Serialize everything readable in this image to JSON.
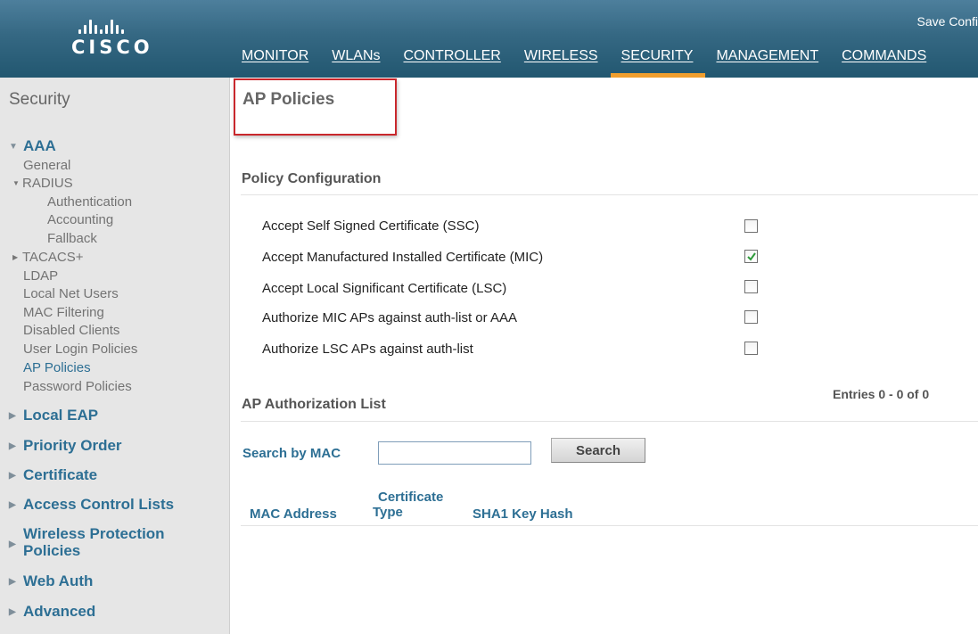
{
  "header": {
    "logo_text": "CISCO",
    "save_config": "Save Confi",
    "nav": [
      {
        "label": "MONITOR"
      },
      {
        "label": "WLANs"
      },
      {
        "label": "CONTROLLER"
      },
      {
        "label": "WIRELESS"
      },
      {
        "label": "SECURITY",
        "active": true
      },
      {
        "label": "MANAGEMENT"
      },
      {
        "label": "COMMANDS"
      }
    ]
  },
  "sidebar": {
    "title": "Security",
    "sections": {
      "aaa": "AAA",
      "local_eap": "Local EAP",
      "priority_order": "Priority Order",
      "certificate": "Certificate",
      "acl": "Access Control Lists",
      "wireless_protection_1": "Wireless Protection",
      "wireless_protection_2": "Policies",
      "web_auth": "Web Auth",
      "advanced": "Advanced"
    },
    "aaa_items": {
      "general": "General",
      "radius": "RADIUS",
      "authentication": "Authentication",
      "accounting": "Accounting",
      "fallback": "Fallback",
      "tacacs": "TACACS+",
      "ldap": "LDAP",
      "local_net_users": "Local Net Users",
      "mac_filtering": "MAC Filtering",
      "disabled_clients": "Disabled Clients",
      "user_login_policies": "User Login Policies",
      "ap_policies": "AP Policies",
      "password_policies": "Password Policies"
    }
  },
  "main": {
    "title": "AP Policies",
    "policy_config": {
      "heading": "Policy Configuration",
      "items": [
        {
          "label": "Accept Self Signed Certificate (SSC)",
          "checked": false
        },
        {
          "label": "Accept Manufactured Installed Certificate (MIC)",
          "checked": true
        },
        {
          "label": "Accept Local Significant Certificate (LSC)",
          "checked": false
        },
        {
          "label": "Authorize MIC APs against auth-list or AAA",
          "checked": false
        },
        {
          "label": "Authorize LSC APs against auth-list",
          "checked": false
        }
      ]
    },
    "auth_list": {
      "heading": "AP Authorization List",
      "entries": "Entries 0 - 0 of 0",
      "search_label": "Search by MAC",
      "search_value": "",
      "search_button": "Search",
      "columns": {
        "mac": "MAC Address",
        "cert_type_1": "Certificate",
        "cert_type_2": "Type",
        "sha1": "SHA1 Key Hash"
      }
    }
  },
  "colors": {
    "header_bg": "#356883",
    "active_tab": "#f09e2d",
    "link_blue": "#2d6f94",
    "highlight_box": "#c9282d",
    "sidebar_bg": "#e6e6e6"
  }
}
